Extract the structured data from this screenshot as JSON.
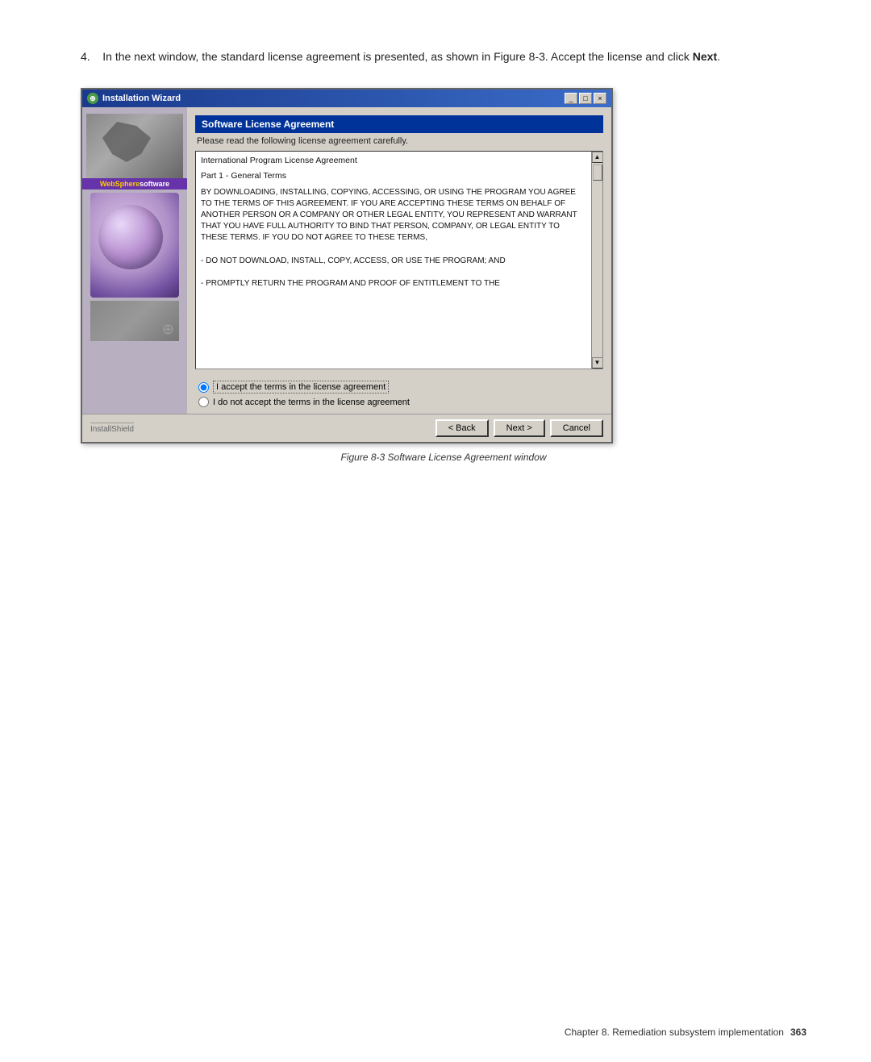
{
  "instruction": {
    "number": "4.",
    "text": "In the next window, the standard license agreement is presented, as shown in Figure 8-3. Accept the license and click ",
    "bold_text": "Next",
    "suffix": "."
  },
  "window": {
    "title": "Installation Wizard",
    "title_icon": "⊕",
    "controls": {
      "minimize": "_",
      "restore": "□",
      "close": "×"
    },
    "sidebar": {
      "websphere_label_part1": "WebSphere",
      "websphere_label_part2": " software"
    },
    "content": {
      "section_title": "Software License Agreement",
      "subtitle": "Please read the following license agreement carefully.",
      "license_header": "International Program License Agreement",
      "license_part": "Part 1 - General Terms",
      "license_body": "BY DOWNLOADING, INSTALLING, COPYING, ACCESSING, OR USING THE PROGRAM YOU AGREE TO THE TERMS OF THIS AGREEMENT. IF YOU ARE ACCEPTING THESE TERMS ON BEHALF OF ANOTHER PERSON OR A COMPANY OR OTHER LEGAL ENTITY, YOU REPRESENT AND WARRANT THAT YOU HAVE FULL AUTHORITY TO BIND THAT PERSON, COMPANY, OR LEGAL ENTITY TO THESE TERMS. IF YOU DO NOT AGREE TO THESE TERMS,",
      "license_bullet1": "- DO NOT DOWNLOAD, INSTALL, COPY, ACCESS, OR USE THE PROGRAM; AND",
      "license_bullet2": "- PROMPTLY RETURN THE PROGRAM AND PROOF OF ENTITLEMENT TO THE",
      "radio_accept": "I accept the terms in the license agreement",
      "radio_decline": "I do not accept the terms in the license agreement"
    },
    "footer": {
      "installshield": "InstallShield",
      "btn_back": "< Back",
      "btn_next": "Next >",
      "btn_cancel": "Cancel"
    }
  },
  "figure_caption": "Figure 8-3   Software License Agreement window",
  "page_footer": {
    "chapter_text": "Chapter 8. Remediation subsystem implementation",
    "page_number": "363"
  }
}
